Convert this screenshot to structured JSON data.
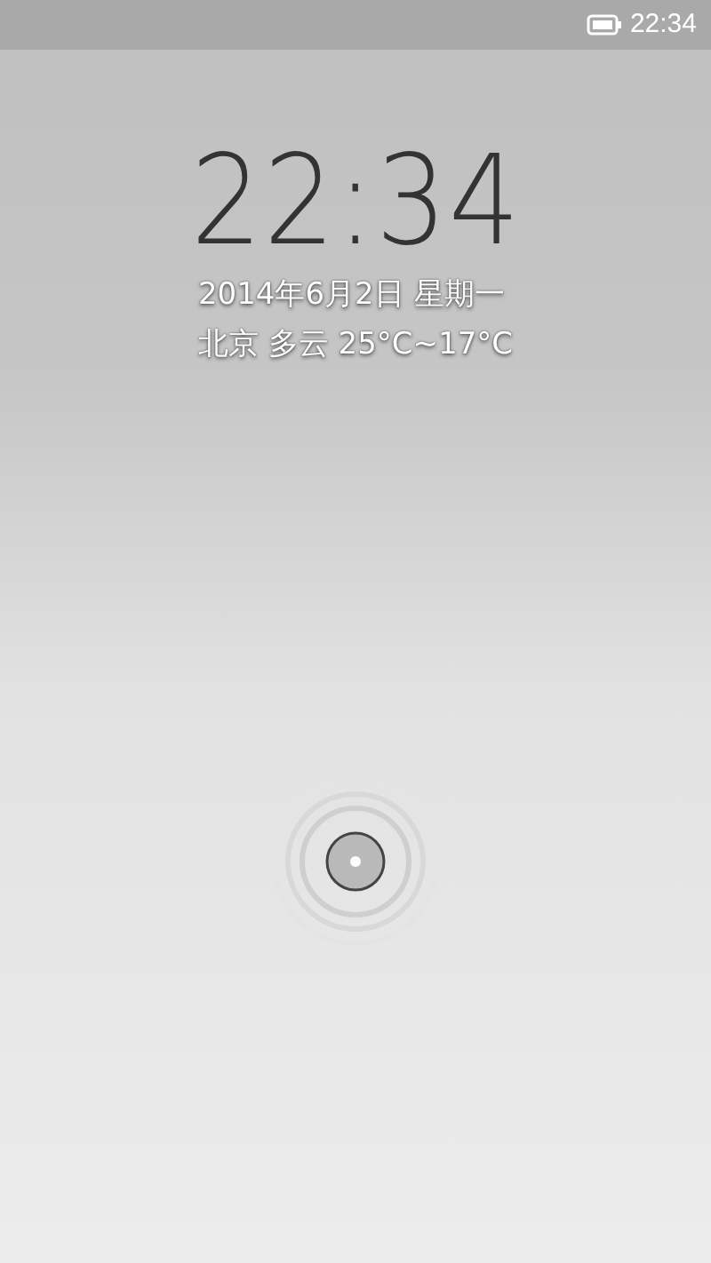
{
  "status_bar": {
    "time": "22:34"
  },
  "clock": {
    "time": "22:34"
  },
  "date": "2014年6月2日 星期一",
  "weather": "北京 多云 25°C~17°C"
}
